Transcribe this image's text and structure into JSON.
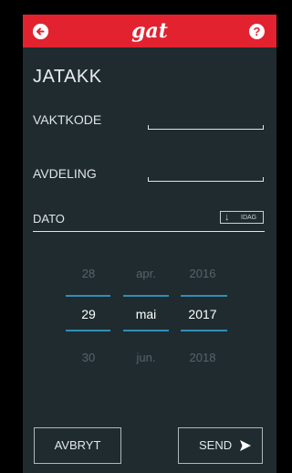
{
  "header": {
    "logo": "gat",
    "back_icon": "arrow-left-icon",
    "help_icon": "question-icon",
    "accent_color": "#e3222f"
  },
  "page": {
    "title": "JATAKK"
  },
  "form": {
    "vaktkode_label": "VAKTKODE",
    "vaktkode_value": "",
    "avdeling_label": "AVDELING",
    "avdeling_value": "",
    "dato_label": "DATO",
    "idag_label": "IDAG",
    "idag_icon": "arrow-down-icon"
  },
  "date_picker": {
    "day": {
      "prev": "28",
      "selected": "29",
      "next": "30"
    },
    "month": {
      "prev": "apr.",
      "selected": "mai",
      "next": "jun."
    },
    "year": {
      "prev": "2016",
      "selected": "2017",
      "next": "2018"
    },
    "selected_line_color": "#2f8fb4"
  },
  "actions": {
    "cancel_label": "AVBRYT",
    "send_label": "SEND",
    "send_icon": "send-icon"
  }
}
